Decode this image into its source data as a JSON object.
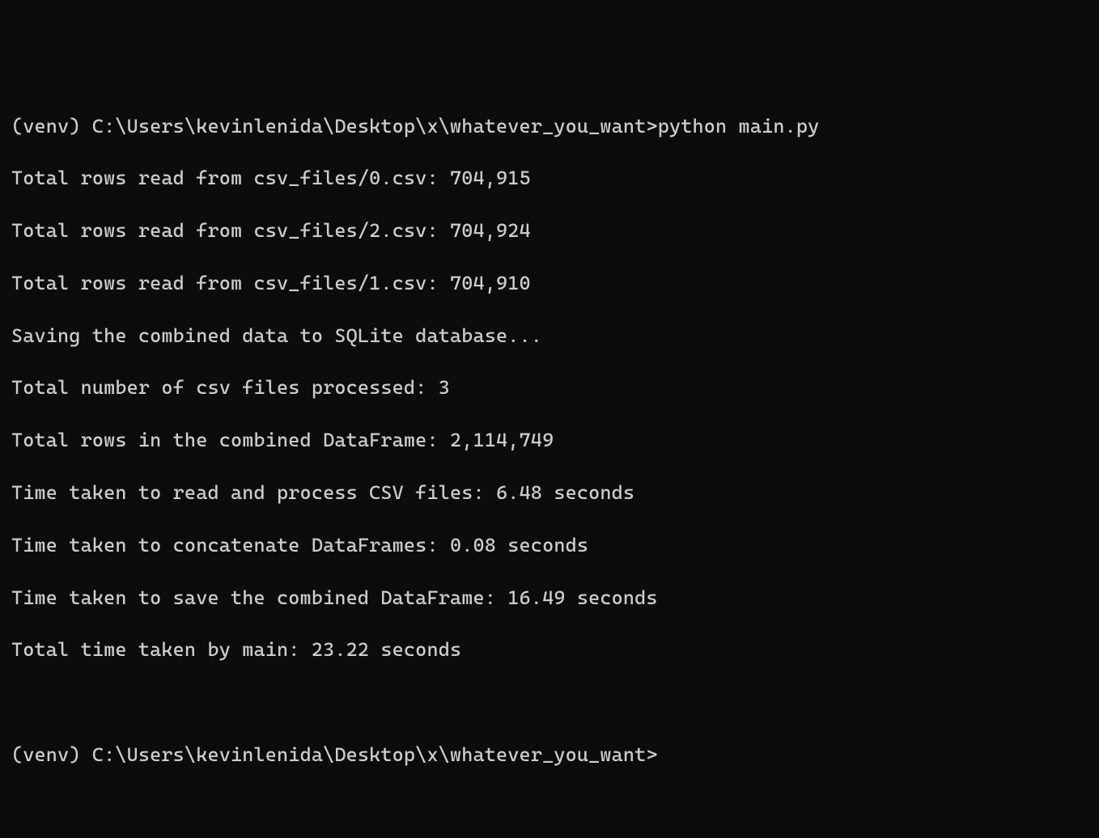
{
  "terminal": {
    "prompt1": {
      "env": "(venv) ",
      "path": "C:\\Users\\kevinlenida\\Desktop\\x\\whatever_you_want>",
      "command": "python main.py"
    },
    "output_lines": [
      "Total rows read from csv_files/0.csv: 704,915",
      "Total rows read from csv_files/2.csv: 704,924",
      "Total rows read from csv_files/1.csv: 704,910",
      "Saving the combined data to SQLite database...",
      "Total number of csv files processed: 3",
      "Total rows in the combined DataFrame: 2,114,749",
      "Time taken to read and process CSV files: 6.48 seconds",
      "Time taken to concatenate DataFrames: 0.08 seconds",
      "Time taken to save the combined DataFrame: 16.49 seconds",
      "Total time taken by main: 23.22 seconds"
    ],
    "prompt2": {
      "env": "(venv) ",
      "path": "C:\\Users\\kevinlenida\\Desktop\\x\\whatever_you_want>",
      "command": ""
    }
  }
}
